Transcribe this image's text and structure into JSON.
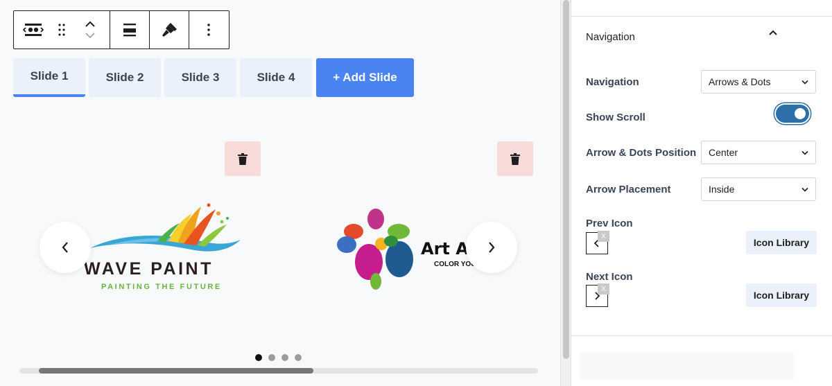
{
  "toolbar": {
    "icons": [
      "block-type-icon",
      "drag-handle-icon",
      "move-up-icon",
      "move-down-icon",
      "align-icon",
      "style-brush-icon",
      "more-options-icon"
    ]
  },
  "slides": {
    "tabs": [
      "Slide 1",
      "Slide 2",
      "Slide 3",
      "Slide 4"
    ],
    "active_index": 0,
    "add_label": "+ Add Slide"
  },
  "carousel": {
    "logo1": {
      "title": "WAVE PAINT",
      "subtitle": "PAINTING THE FUTURE"
    },
    "logo2": {
      "title": "Art Ac",
      "subtitle": "COLOR YOUR L"
    },
    "dots_count": 4,
    "active_dot": 0
  },
  "panel": {
    "section_title": "Navigation",
    "navigation": {
      "label": "Navigation",
      "value": "Arrows & Dots"
    },
    "show_scroll": {
      "label": "Show Scroll",
      "enabled": true
    },
    "position": {
      "label": "Arrow & Dots Position",
      "value": "Center"
    },
    "placement": {
      "label": "Arrow Placement",
      "value": "Inside"
    },
    "prev_icon": {
      "label": "Prev Icon",
      "remove": "X",
      "button": "Icon Library"
    },
    "next_icon": {
      "label": "Next Icon",
      "remove": "X",
      "button": "Icon Library"
    }
  },
  "colors": {
    "accent": "#4a84f0",
    "toggle_on": "#2d6fa8",
    "delete_bg": "#f9dcda",
    "tab_bg": "#eaf1fb"
  }
}
